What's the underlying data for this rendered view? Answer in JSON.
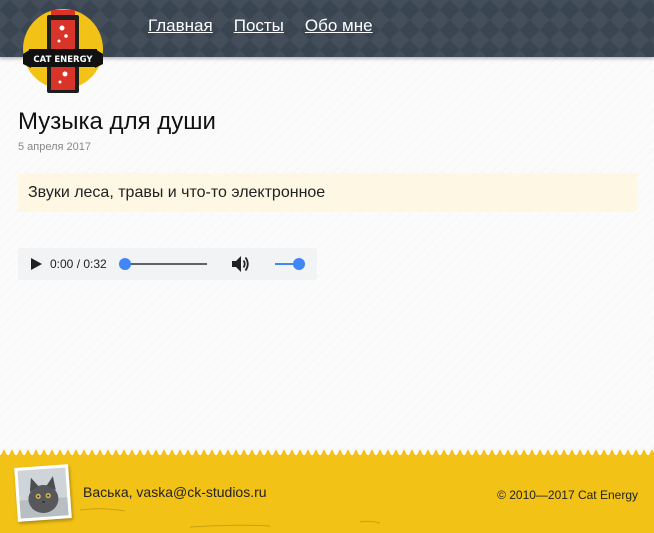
{
  "header": {
    "logo_text": "CAT ENERGY",
    "nav": [
      {
        "label": "Главная"
      },
      {
        "label": "Посты"
      },
      {
        "label": "Обо мне"
      }
    ]
  },
  "post": {
    "title": "Музыка для души",
    "date": "5 апреля 2017",
    "excerpt": "Звуки леса, травы и что-то электронное"
  },
  "audio": {
    "current_time": "0:00",
    "separator": " / ",
    "duration": "0:32",
    "progress": 0,
    "volume": 1
  },
  "footer": {
    "author": "Васька, vaska@ck-studios.ru",
    "copyright": "© 2010—2017 Cat Energy"
  },
  "colors": {
    "header_bg": "#3a4552",
    "footer_bg": "#f2c316",
    "excerpt_bg": "#fdf7e3",
    "accent": "#4285f4"
  }
}
